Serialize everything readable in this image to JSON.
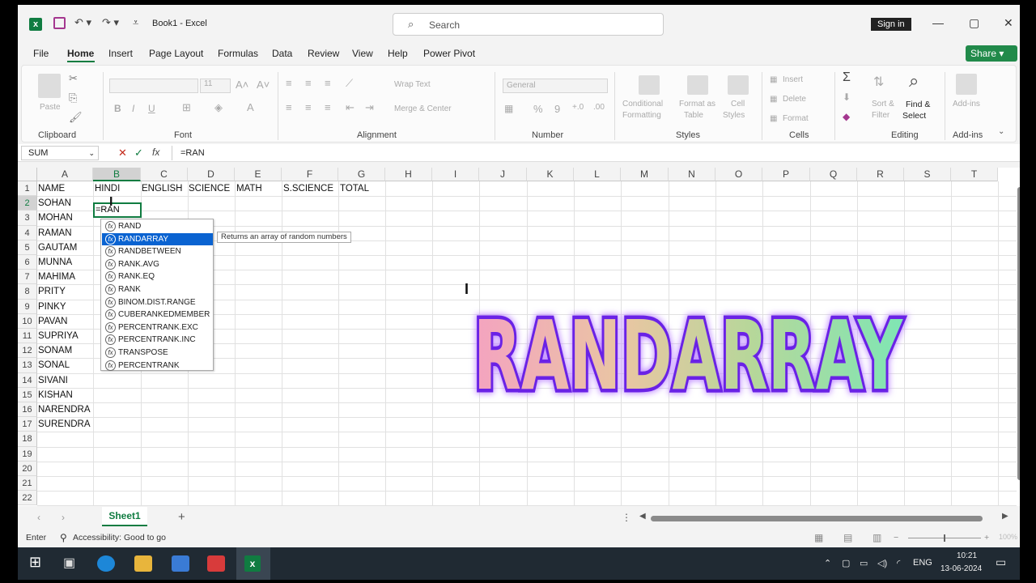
{
  "window": {
    "title": "Book1  -  Excel",
    "search_placeholder": "Search",
    "signin": "Sign in"
  },
  "menu": [
    "File",
    "Home",
    "Insert",
    "Page Layout",
    "Formulas",
    "Data",
    "Review",
    "View",
    "Help",
    "Power Pivot"
  ],
  "share": "Share",
  "ribbon": {
    "groups": [
      "Clipboard",
      "Font",
      "Alignment",
      "Number",
      "Styles",
      "Cells",
      "Editing",
      "Add-ins"
    ],
    "paste": "Paste",
    "font_size": "11",
    "wrap_text": "Wrap Text",
    "merge": "Merge & Center",
    "number_format": "General",
    "conditional_1": "Conditional",
    "conditional_2": "Formatting",
    "format_as_1": "Format as",
    "format_as_2": "Table",
    "cell_styles_1": "Cell",
    "cell_styles_2": "Styles",
    "insert": "Insert",
    "delete": "Delete",
    "format": "Format",
    "sort_1": "Sort &",
    "sort_2": "Filter",
    "find_1": "Find &",
    "find_2": "Select",
    "addins": "Add-ins"
  },
  "formula_bar": {
    "name_box": "SUM",
    "formula": "=RAN"
  },
  "grid": {
    "columns": [
      "A",
      "B",
      "C",
      "D",
      "E",
      "F",
      "G",
      "H",
      "I",
      "J",
      "K",
      "L",
      "M",
      "N",
      "O",
      "P",
      "Q",
      "R",
      "S",
      "T"
    ],
    "rows": [
      "1",
      "2",
      "3",
      "4",
      "5",
      "6",
      "7",
      "8",
      "9",
      "10",
      "11",
      "12",
      "13",
      "14",
      "15",
      "16",
      "17",
      "18",
      "19",
      "20",
      "21",
      "22"
    ],
    "headers": [
      "NAME",
      "HINDI",
      "ENGLISH",
      "SCIENCE",
      "MATH",
      "S.SCIENCE",
      "TOTAL"
    ],
    "names": [
      "SOHAN",
      "MOHAN",
      "RAMAN",
      "GAUTAM",
      "MUNNA",
      "MAHIMA",
      "PRITY",
      "PINKY",
      "PAVAN",
      "SUPRIYA",
      "SONAM",
      "SONAL",
      "SIVANI",
      "KISHAN",
      "NARENDRA",
      "SURENDRA"
    ],
    "active_input": "=RAN"
  },
  "autocomplete": {
    "items": [
      "RAND",
      "RANDARRAY",
      "RANDBETWEEN",
      "RANK.AVG",
      "RANK.EQ",
      "RANK",
      "BINOM.DIST.RANGE",
      "CUBERANKEDMEMBER",
      "PERCENTRANK.EXC",
      "PERCENTRANK.INC",
      "TRANSPOSE",
      "PERCENTRANK"
    ],
    "highlighted": "RANDARRAY",
    "tooltip": "Returns an array of random numbers"
  },
  "overlay_title": "RANDARRAY",
  "sheet_tab": "Sheet1",
  "status": {
    "mode": "Enter",
    "accessibility": "Accessibility: Good to go",
    "zoom": "100%"
  },
  "taskbar": {
    "lang": "ENG",
    "time": "10:21",
    "date": "13-06-2024"
  }
}
